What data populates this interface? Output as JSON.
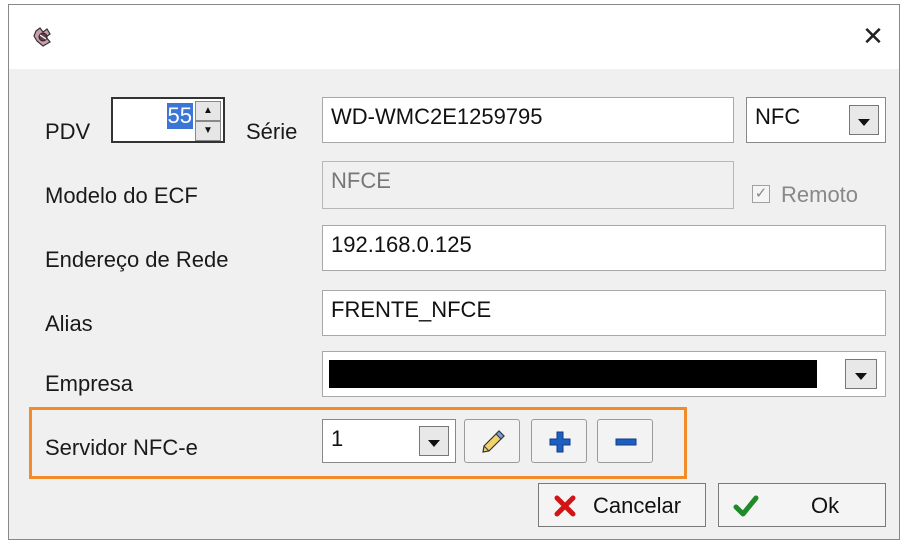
{
  "dialog": {
    "close_symbol": "✕"
  },
  "pdv": {
    "label": "PDV",
    "value": "55"
  },
  "serie": {
    "label": "Série",
    "value": "WD-WMC2E1259795"
  },
  "tipo": {
    "selected": "NFC"
  },
  "modelo": {
    "label": "Modelo do ECF",
    "value": "NFCE"
  },
  "remoto": {
    "label": "Remoto",
    "checked": true,
    "check_mark": "✓"
  },
  "endereco": {
    "label": "Endereço de Rede",
    "value": "192.168.0.125"
  },
  "alias": {
    "label": "Alias",
    "value": "FRENTE_NFCE"
  },
  "empresa": {
    "label": "Empresa"
  },
  "servidor": {
    "label": "Servidor NFC-e",
    "value": "1"
  },
  "buttons": {
    "cancel_label": "Cancelar",
    "ok_label": "Ok"
  },
  "icons": [
    "app-icon",
    "close-icon",
    "spin-up-icon",
    "spin-down-icon",
    "dropdown-arrow-icon",
    "edit-pencil-icon",
    "plus-icon",
    "minus-icon",
    "x-icon",
    "checkmark-icon"
  ],
  "colors": {
    "highlight": "#f28c2b",
    "selection": "#3b76d6",
    "cancel_icon": "#d11414",
    "ok_icon": "#1f8a2a",
    "toolbar_icon": "#1c5fc1"
  }
}
